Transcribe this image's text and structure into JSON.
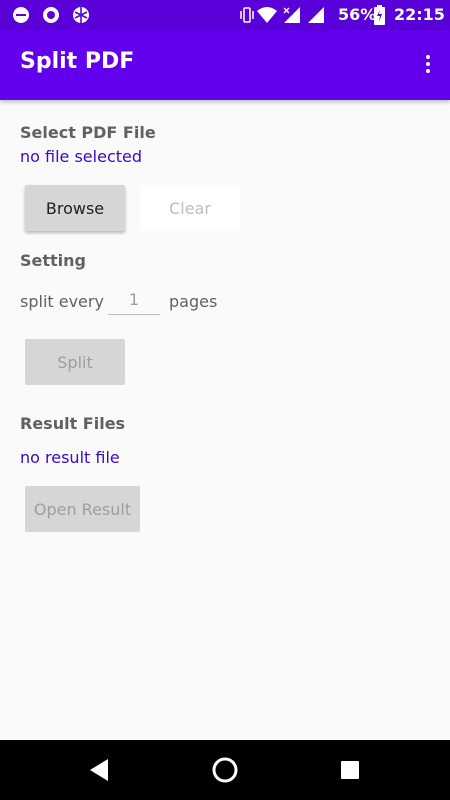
{
  "status_bar": {
    "battery": "56%",
    "time": "22:15",
    "icons": [
      "minus-circle-icon",
      "record-icon",
      "browser-globe-icon",
      "vibrate-icon",
      "wifi-icon",
      "signal-icon",
      "battery-icon"
    ]
  },
  "app_bar": {
    "title": "Split PDF",
    "menu_icon": "more-vert-icon"
  },
  "select_section": {
    "heading": "Select PDF File",
    "status": "no file selected",
    "browse_label": "Browse",
    "clear_label": "Clear"
  },
  "setting_section": {
    "heading": "Setting",
    "prefix": "split every",
    "pages_value": "1",
    "suffix": "pages",
    "split_label": "Split"
  },
  "result_section": {
    "heading": "Result Files",
    "status": "no result file",
    "open_label": "Open Result"
  },
  "nav_bar": {
    "icons": [
      "back-icon",
      "home-icon",
      "recents-icon"
    ]
  },
  "colors": {
    "primary": "#6200ee",
    "status_bar": "#5a00d8",
    "link_text": "#3f07c8"
  }
}
